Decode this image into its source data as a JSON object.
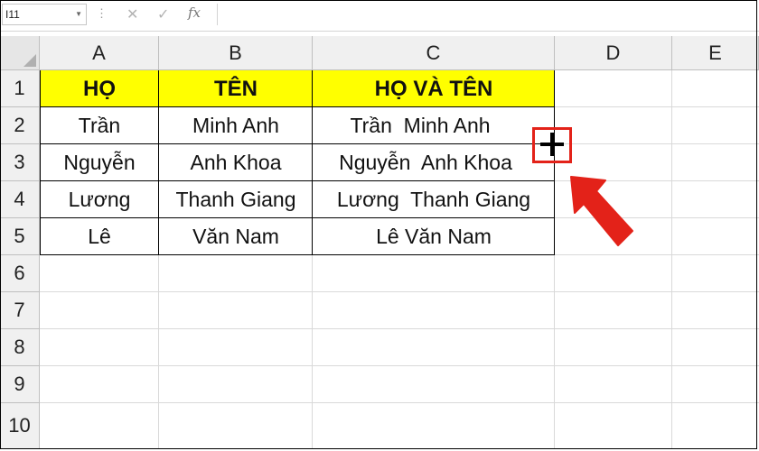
{
  "formula_bar": {
    "name_box": "I11",
    "cancel_icon": "✕",
    "enter_icon": "✓",
    "fx_label": "fx"
  },
  "columns": [
    "A",
    "B",
    "C",
    "D",
    "E"
  ],
  "rows": [
    "1",
    "2",
    "3",
    "4",
    "5",
    "6",
    "7",
    "8",
    "9",
    "10"
  ],
  "table": {
    "headers": [
      "HỌ",
      "TÊN",
      "HỌ VÀ TÊN"
    ],
    "rows": [
      [
        "Trần",
        "Minh Anh",
        "Trần  Minh Anh"
      ],
      [
        "Nguyễn",
        "Anh Khoa",
        "Nguyễn  Anh Khoa"
      ],
      [
        "Lương",
        "Thanh Giang",
        "Lương  Thanh Giang"
      ],
      [
        "Lê",
        "Văn Nam",
        "Lê Văn Nam"
      ]
    ]
  },
  "colors": {
    "header_fill": "#ffff00",
    "highlight": "#e32219"
  },
  "annotations": {
    "fill_handle_icon": "plus-cursor-icon",
    "pointer_icon": "red-arrow-icon"
  }
}
